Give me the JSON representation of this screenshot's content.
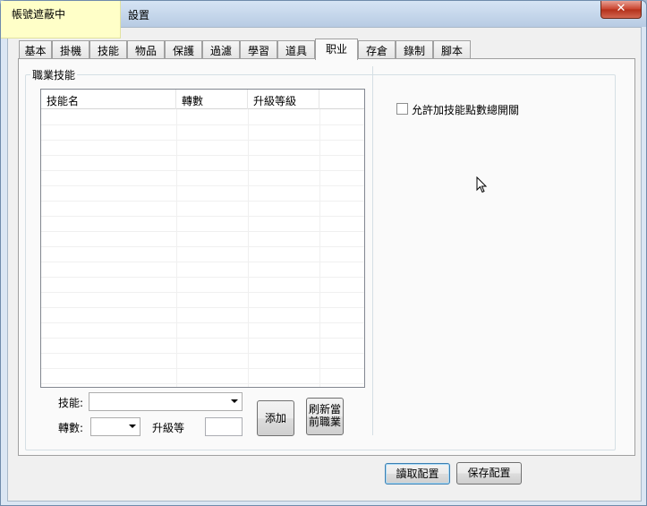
{
  "window": {
    "title": "設置",
    "close_symbol": "✕"
  },
  "sticky_note": "帳號遮蔽中",
  "tabs": [
    {
      "label": "基本"
    },
    {
      "label": "掛機"
    },
    {
      "label": "技能"
    },
    {
      "label": "物品"
    },
    {
      "label": "保護"
    },
    {
      "label": "過濾"
    },
    {
      "label": "學習"
    },
    {
      "label": "道具"
    },
    {
      "label": "职业"
    },
    {
      "label": "存倉"
    },
    {
      "label": "錄制"
    },
    {
      "label": "腳本"
    }
  ],
  "active_tab": "职业",
  "group": {
    "title": "職業技能"
  },
  "skill_list": {
    "columns": [
      "技能名",
      "轉數",
      "升級等級"
    ],
    "rows": []
  },
  "form": {
    "skill_label": "技能:",
    "skill_value": "",
    "turn_label": "轉數:",
    "turn_value": "",
    "upgrade_label": "升級等",
    "upgrade_value": "",
    "add_button": "添加",
    "refresh_button_line1": "刷新當",
    "refresh_button_line2": "前職業"
  },
  "options": {
    "allow_skill_points_label": "允許加技能點數總開關",
    "allow_skill_points_checked": false
  },
  "footer": {
    "read_button": "讀取配置",
    "save_button": "保存配置"
  }
}
